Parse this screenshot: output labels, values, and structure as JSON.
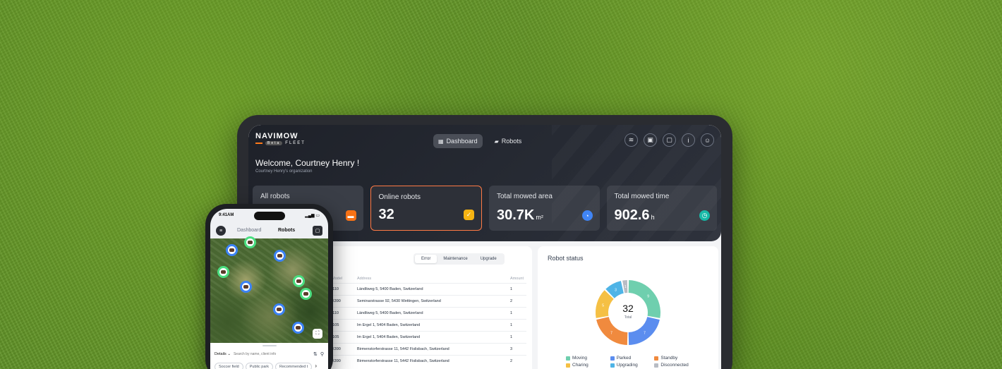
{
  "brand": {
    "name": "NAVIMOW",
    "sub": "FLEET",
    "badge": "Beta"
  },
  "nav": {
    "dashboard": "Dashboard",
    "robots": "Robots"
  },
  "welcome": "Welcome, Courtney Henry !",
  "org": "Courtney Henry's organization",
  "stats": [
    {
      "label": "All robots",
      "value": "",
      "unit": "",
      "icon": "robot-icon",
      "color": "#f97316"
    },
    {
      "label": "Online robots",
      "value": "32",
      "unit": "",
      "icon": "check-icon",
      "color": "#f5b312"
    },
    {
      "label": "Total mowed area",
      "value": "30.7K",
      "unit": "m²",
      "icon": "pie-icon",
      "color": "#3b82f6"
    },
    {
      "label": "Total mowed time",
      "value": "902.6",
      "unit": "h",
      "icon": "timer-icon",
      "color": "#14b8a6"
    }
  ],
  "table": {
    "filters": [
      "Error",
      "Maintenance",
      "Upgrade"
    ],
    "active_filter": "Error",
    "headers": {
      "model": "Model",
      "address": "Address",
      "amount": "Amount"
    },
    "rows": [
      {
        "model": "i110",
        "address": "Ländliweg 5, 5400 Baden, Switzerland",
        "amount": "1"
      },
      {
        "model": "X390",
        "address": "Seminarstrasse 92, 5430 Wettingen, Switzerland",
        "amount": "2"
      },
      {
        "model": "i110",
        "address": "Ländliweg 5, 5400 Baden, Switzerland",
        "amount": "1"
      },
      {
        "model": "i105",
        "address": "Im Ergel 1, 5404 Baden, Switzerland",
        "amount": "1"
      },
      {
        "model": "i105",
        "address": "Im Ergel 1, 5404 Baden, Switzerland",
        "amount": "1"
      },
      {
        "model": "X390",
        "address": "Birmenstorferstrasse 11, 5442 Fislisbach, Switzerland",
        "amount": "3"
      },
      {
        "model": "X390",
        "address": "Birmenstorferstrasse 11, 5442 Fislisbach, Switzerland",
        "amount": "2"
      }
    ]
  },
  "robot_status": {
    "title": "Robot status",
    "total": "32",
    "total_label": "Total",
    "segments": [
      {
        "name": "Moving",
        "value": 9,
        "label": "9",
        "color": "#6fcfae"
      },
      {
        "name": "Parked",
        "value": 7,
        "label": "7",
        "color": "#5b8def"
      },
      {
        "name": "Standby",
        "value": 7,
        "label": "7",
        "color": "#f08a3e"
      },
      {
        "name": "Charing",
        "value": 5,
        "label": "5",
        "color": "#f5c044"
      },
      {
        "name": "Upgrading",
        "value": 3,
        "label": "3",
        "color": "#4fb4e6"
      },
      {
        "name": "Disconnected",
        "value": 1,
        "label": "1",
        "color": "#b8bcc4"
      }
    ]
  },
  "phone": {
    "time": "9:41AM",
    "tabs": [
      "Dashboard",
      "Robots"
    ],
    "details": "Details ⌄",
    "search_placeholder": "Search by name, client info",
    "chips": [
      "Soccer field",
      "Public park",
      "Recommended t"
    ]
  }
}
